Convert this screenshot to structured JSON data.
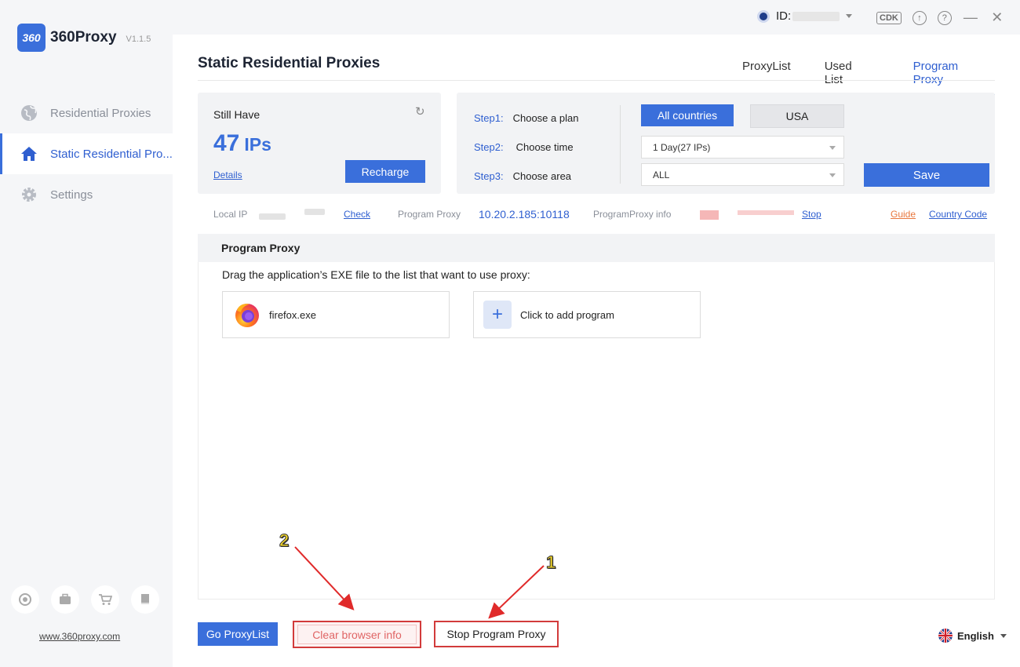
{
  "app": {
    "name": "360Proxy",
    "logo_badge": "360",
    "version": "V1.1.5",
    "website": "www.360proxy.com",
    "accent_color": "#3a6fdb",
    "highlight_color": "#d23b3b"
  },
  "sidebar": {
    "items": [
      {
        "label": "Residential Proxies",
        "icon": "globe-icon",
        "active": false
      },
      {
        "label": "Static Residential Pro...",
        "icon": "home-icon",
        "active": true
      },
      {
        "label": "Settings",
        "icon": "gear-icon",
        "active": false
      }
    ],
    "bottom_icons": [
      "support-icon",
      "briefcase-icon",
      "cart-icon",
      "book-icon"
    ]
  },
  "topbar": {
    "id_label": "ID:",
    "cdk_label": "CDK",
    "upload_icon": "↑",
    "help_icon": "?",
    "minimize_icon": "—",
    "close_icon": "✕"
  },
  "page": {
    "title": "Static Residential Proxies",
    "tabs": [
      {
        "label": "ProxyList",
        "active": false
      },
      {
        "label": "Used List",
        "active": false
      },
      {
        "label": "Program Proxy",
        "active": true
      }
    ]
  },
  "balance": {
    "label": "Still Have",
    "count": "47",
    "unit": "IPs",
    "details_link": "Details",
    "recharge_button": "Recharge",
    "refresh_icon": "↻"
  },
  "steps": {
    "step1": {
      "num": "Step1:",
      "text": "Choose a plan"
    },
    "step2": {
      "num": "Step2:",
      "text": "Choose time"
    },
    "step3": {
      "num": "Step3:",
      "text": "Choose area"
    },
    "all_countries_button": "All countries",
    "usa_button": "USA",
    "time_select": "1 Day(27 IPs)",
    "area_select": "ALL",
    "save_button": "Save"
  },
  "info_bar": {
    "local_ip_label": "Local IP",
    "check_link": "Check",
    "program_proxy_label": "Program Proxy",
    "program_proxy_value": "10.20.2.185:10118",
    "program_proxy_info_label": "ProgramProxy info",
    "stop_link": "Stop",
    "guide_link": "Guide",
    "country_code_link": "Country Code"
  },
  "program_proxy": {
    "header": "Program Proxy",
    "description": "Drag the application’s EXE file to the list that want to use proxy:",
    "programs": [
      {
        "name": "firefox.exe",
        "icon": "firefox-icon"
      }
    ],
    "add_label": "Click to add program",
    "add_icon": "+"
  },
  "footer": {
    "go_proxylist_button": "Go ProxyList",
    "clear_browser_button": "Clear browser info",
    "stop_program_button": "Stop Program Proxy",
    "language": "English"
  },
  "annotations": {
    "label_1": "1",
    "label_2": "2"
  }
}
